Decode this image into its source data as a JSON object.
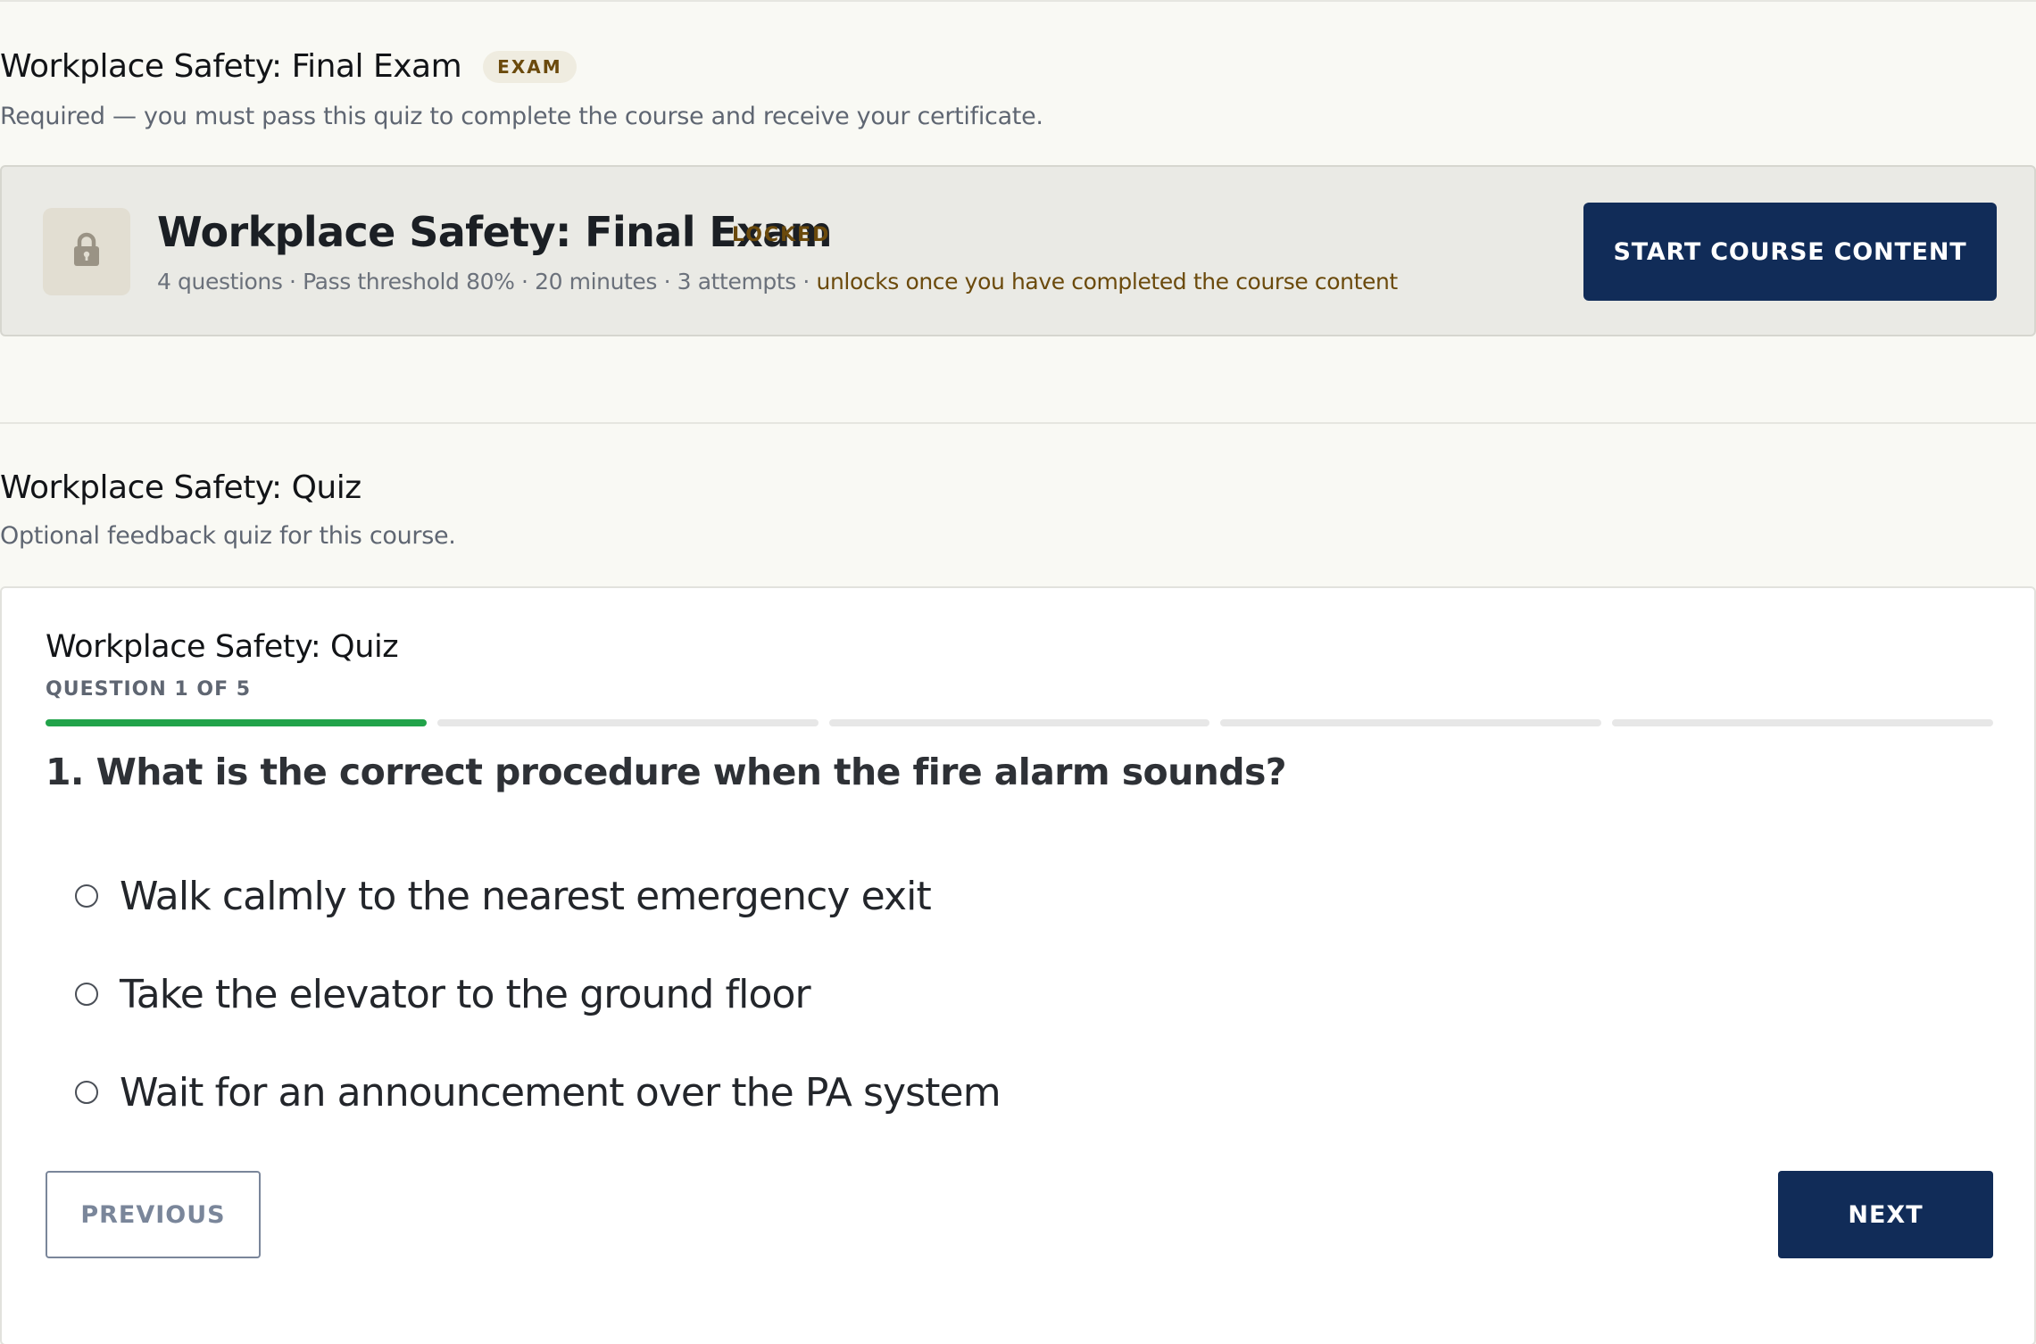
{
  "exam_section": {
    "title": "Workplace Safety: Final Exam",
    "badge": "EXAM",
    "description": "Required — you must pass this quiz to complete the course and receive your certificate.",
    "card": {
      "icon": "lock-icon",
      "title": "Workplace Safety: Final Exam",
      "status": "LOCKED",
      "meta": "4 questions · Pass threshold 80% · 20 minutes · 3 attempts · ",
      "unlock_note": "unlocks once you have completed the course content",
      "button_label": "START COURSE CONTENT"
    }
  },
  "quiz_section": {
    "title": "Workplace Safety: Quiz",
    "description": "Optional feedback quiz for this course.",
    "card": {
      "title": "Workplace Safety: Quiz",
      "progress_label": "QUESTION 1 OF 5",
      "progress": {
        "current": 1,
        "total": 5
      },
      "question": "1. What is the correct procedure when the fire alarm sounds?",
      "options": [
        {
          "label": "Walk calmly to the nearest emergency exit",
          "selected": false
        },
        {
          "label": "Take the elevator to the ground floor",
          "selected": false
        },
        {
          "label": "Wait for an announcement over the PA system",
          "selected": false
        }
      ],
      "previous_label": "PREVIOUS",
      "next_label": "NEXT"
    }
  },
  "colors": {
    "primary": "#112c58",
    "progress_active": "#22a34a",
    "warning_text": "#6b4a0c",
    "background": "#f9f9f4"
  }
}
